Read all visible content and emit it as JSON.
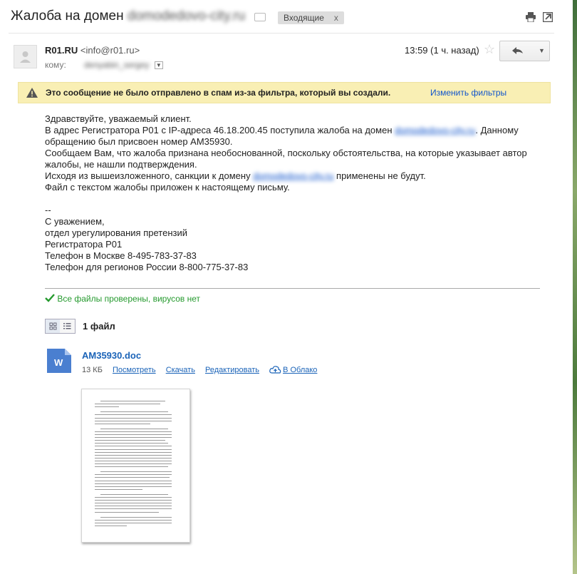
{
  "subject": {
    "prefix": "Жалоба на домен ",
    "domain_redacted": "domodedovo-city.ru",
    "inbox_label": "Входящие",
    "inbox_close": "x"
  },
  "header": {
    "sender_name": "R01.RU",
    "sender_email": "<info@r01.ru>",
    "to_label": "кому:",
    "to_value_redacted": "denyabin_sergey",
    "time": "13:59 (1 ч. назад)",
    "star_glyph": "☆",
    "more_glyph": "▼"
  },
  "warning": {
    "text": "Это сообщение не было отправлено в спам из-за фильтра, который вы создали.",
    "link": "Изменить фильтры"
  },
  "body": {
    "line1": "Здравствуйте, уважаемый клиент.",
    "line2_a": "В адрес Регистратора Р01 с IP-адреса 46.18.200.45 поступила жалоба на домен ",
    "line2_link": "domodedovo-city.ru",
    "line2_b": ". Данному",
    "line3": "обращению был присвоен номер AM35930.",
    "line4": "Сообщаем Вам, что жалоба признана необоснованной, поскольку обстоятельства, на которые указывает автор",
    "line5": "жалобы, не нашли подтверждения.",
    "line6_a": "Исходя из вышеизложенного, санкции к домену ",
    "line6_link": "domodedovo-city.ru",
    "line6_b": " применены не будут.",
    "line7": "Файл с текстом жалобы приложен к настоящему письму.",
    "sig_dash": "--",
    "sig1": "С уважением,",
    "sig2": "отдел урегулирования претензий",
    "sig3": "Регистратора Р01",
    "sig4": "Телефон в Москве 8-495-783-37-83",
    "sig5": "Телефон для регионов России 8-800-775-37-83"
  },
  "attachments": {
    "virus_check": "Все файлы проверены, вирусов нет",
    "count": "1 файл",
    "file": {
      "name": "AM35930.doc",
      "size": "13 КБ",
      "actions": [
        "Посмотреть",
        "Скачать",
        "Редактировать"
      ],
      "cloud": "В Облако"
    }
  },
  "colors": {
    "link": "#1155cc",
    "warning_bg": "#f9efb4",
    "success": "#259a2e",
    "doc_icon": "#4a7fd0"
  }
}
